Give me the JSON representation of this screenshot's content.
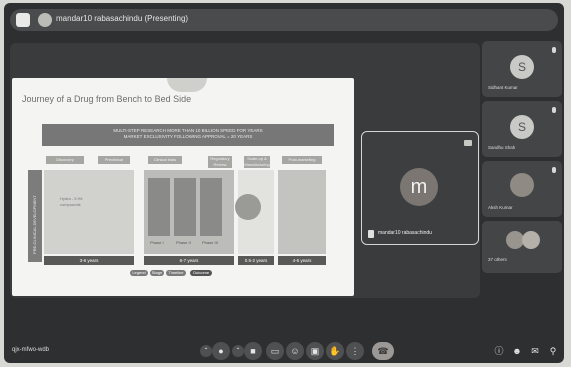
{
  "topbar": {
    "presenter_title": "mandar10 rabasachindu (Presenting)"
  },
  "slide": {
    "title": "Journey of a Drug from Bench to Bed Side",
    "banner_line1": "MULTI-STEP RESEARCH MORE THAN 10 BILLION SPEED FOR YEARS",
    "banner_line2": "MARKET EXCLUSIVITY FOLLOWING APPROVAL = 20 YEARS",
    "vertical_label": "PRE-CLINICAL DEVELOPMENT",
    "chips": [
      "Discovery",
      "Preclinical",
      "Clinical trials",
      "Regulatory Review",
      "Scale-up & Manufacturing",
      "Post-marketing"
    ],
    "inner_text": [
      "Hydra - 5 Hit",
      "compounds"
    ],
    "phase_labels": [
      "Phase I",
      "Phase II",
      "Phase III"
    ],
    "years": [
      "3-6 years",
      "6-7 years",
      "0.5-2 years",
      "4-6 years"
    ],
    "legend": [
      "Legend",
      "Stage",
      "Timeline",
      "Outcome"
    ]
  },
  "main_participant": {
    "initial": "m",
    "name": "mandar10 rabasachindu"
  },
  "participants": [
    {
      "initial": "S",
      "name": "Sidhant Kumar"
    },
    {
      "initial": "S",
      "name": "Sandhu Shah"
    },
    {
      "initial": "",
      "name": "Aksh Kumar"
    },
    {
      "initial": "",
      "name": "37 others"
    }
  ],
  "bottombar": {
    "meeting_code": "qjx-mfwo-wdb",
    "controls": [
      "mic-icon",
      "camera-icon",
      "captions-icon",
      "emoji-icon",
      "present-icon",
      "raise-hand-icon",
      "more-icon"
    ],
    "end_call": "end-call-icon",
    "right_icons": [
      "info-icon",
      "people-icon",
      "chat-icon",
      "activities-icon"
    ]
  }
}
